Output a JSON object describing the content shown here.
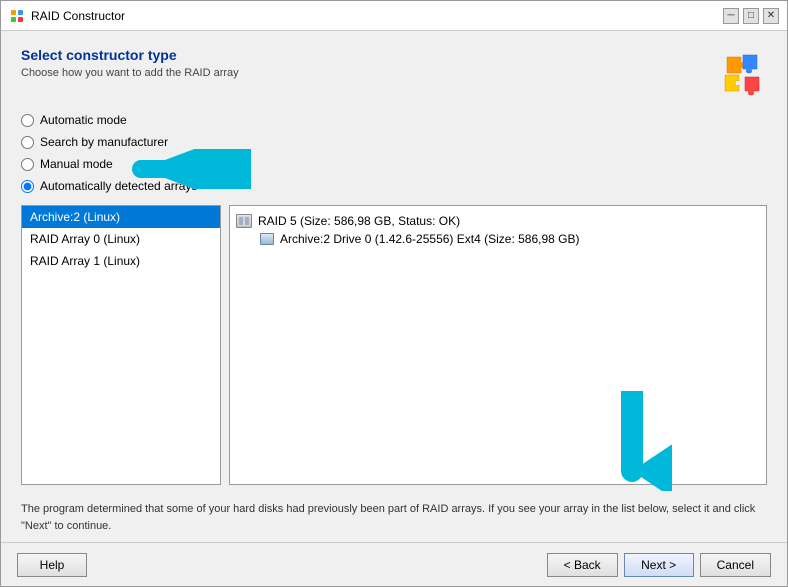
{
  "window": {
    "title": "RAID Constructor"
  },
  "header": {
    "title": "Select constructor type",
    "subtitle": "Choose how you want to add the RAID array"
  },
  "radio_options": [
    {
      "id": "auto",
      "label": "Automatic mode",
      "checked": false
    },
    {
      "id": "manufacturer",
      "label": "Search by manufacturer",
      "checked": false
    },
    {
      "id": "manual",
      "label": "Manual mode",
      "checked": false
    },
    {
      "id": "detected",
      "label": "Automatically detected arrays",
      "checked": true
    }
  ],
  "list_items": [
    {
      "label": "Archive:2 (Linux)",
      "selected": true
    },
    {
      "label": "RAID Array 0 (Linux)",
      "selected": false
    },
    {
      "label": "RAID Array 1 (Linux)",
      "selected": false
    }
  ],
  "detail_items": [
    {
      "label": "RAID 5 (Size: 586,98 GB, Status: OK)",
      "type": "raid",
      "children": [
        {
          "label": "Archive:2 Drive 0 (1.42.6-25556) Ext4 (Size: 586,98 GB)",
          "type": "drive"
        }
      ]
    }
  ],
  "info_text": "The program determined that some of your hard disks had previously been part of RAID arrays. If you see your array in the list below, select it and click \"Next\" to continue.",
  "buttons": {
    "help": "Help",
    "back": "< Back",
    "next": "Next >",
    "cancel": "Cancel"
  },
  "title_buttons": {
    "minimize": "─",
    "maximize": "□",
    "close": "✕"
  }
}
